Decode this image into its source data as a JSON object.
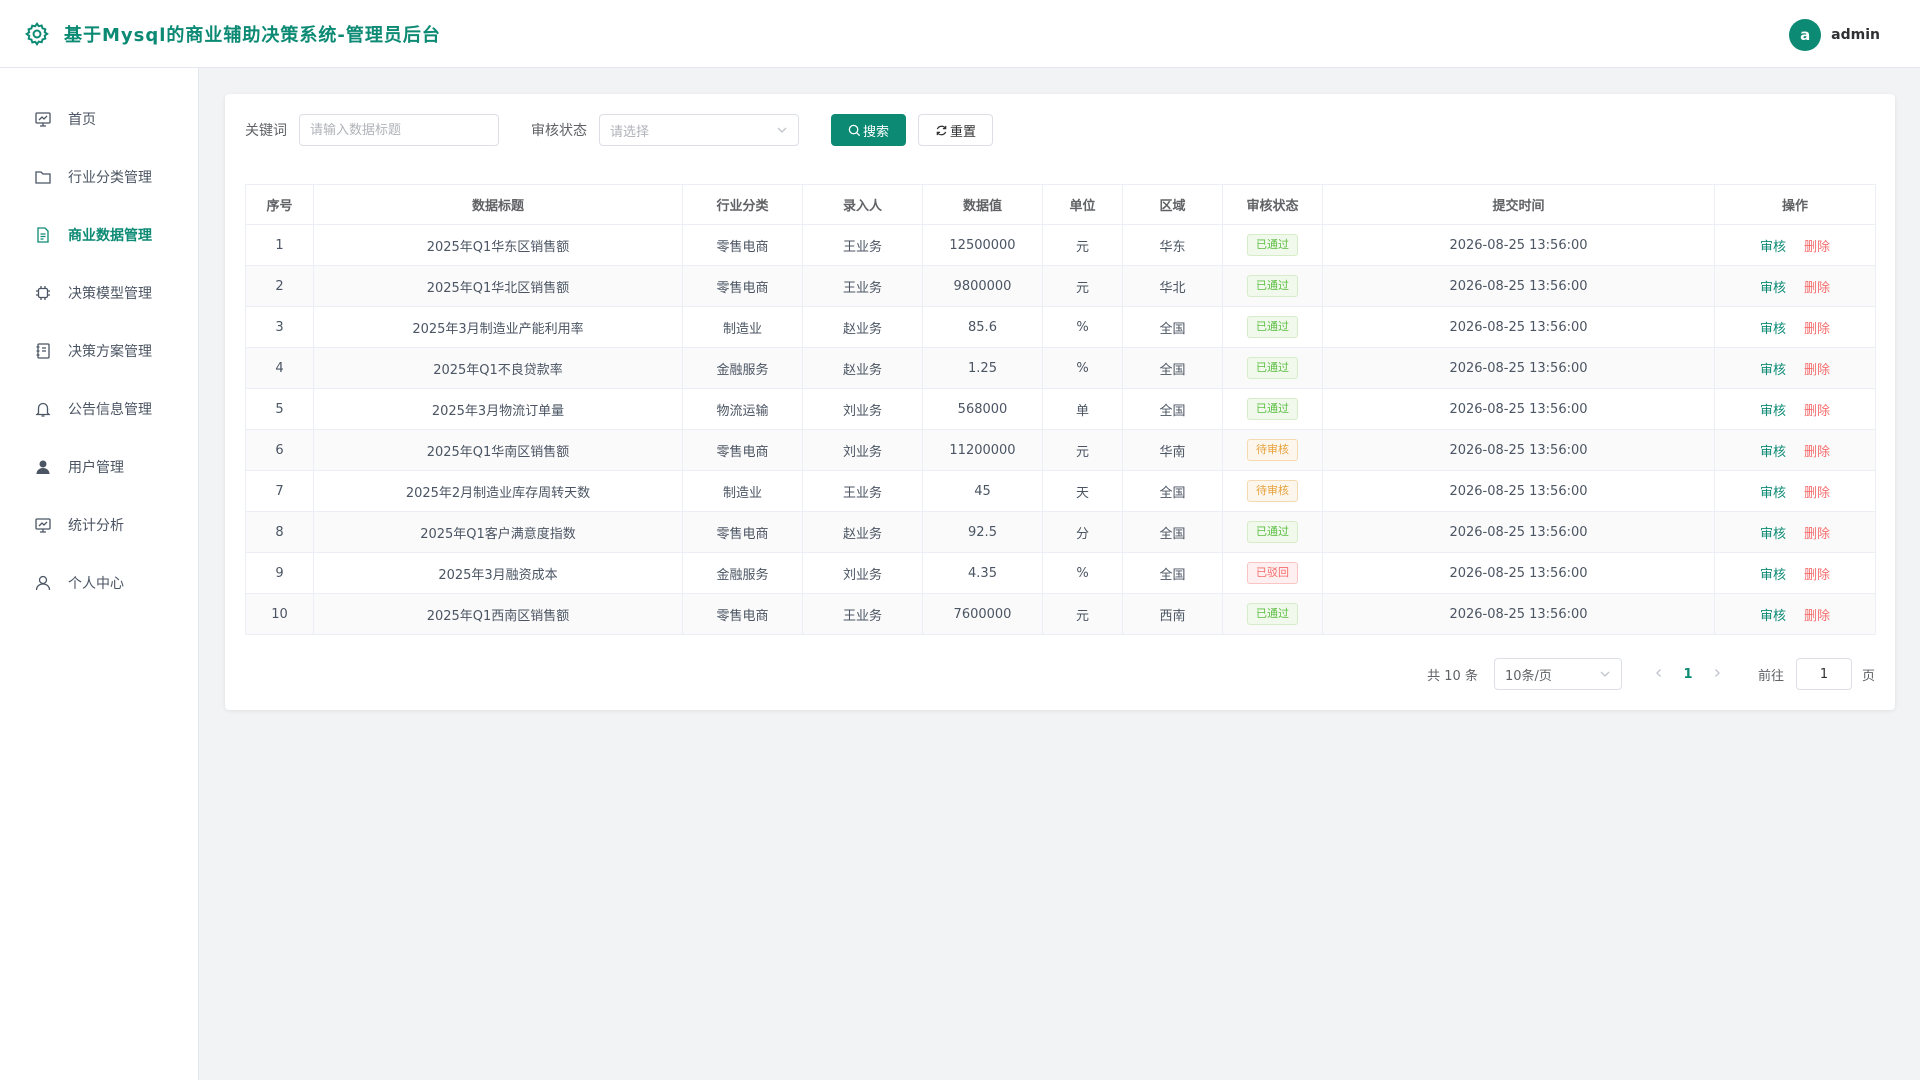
{
  "header": {
    "title": "基于Mysql的商业辅助决策系统-管理员后台",
    "avatar_letter": "a",
    "username": "admin"
  },
  "sidebar": {
    "items": [
      {
        "label": "首页",
        "icon": "chart-board-icon",
        "active": false
      },
      {
        "label": "行业分类管理",
        "icon": "folder-icon",
        "active": false
      },
      {
        "label": "商业数据管理",
        "icon": "document-icon",
        "active": true
      },
      {
        "label": "决策模型管理",
        "icon": "cpu-icon",
        "active": false
      },
      {
        "label": "决策方案管理",
        "icon": "notebook-icon",
        "active": false
      },
      {
        "label": "公告信息管理",
        "icon": "bell-icon",
        "active": false
      },
      {
        "label": "用户管理",
        "icon": "user-filled-icon",
        "active": false
      },
      {
        "label": "统计分析",
        "icon": "chart-board-icon",
        "active": false
      },
      {
        "label": "个人中心",
        "icon": "user-icon",
        "active": false
      }
    ]
  },
  "filters": {
    "keyword_label": "关键词",
    "keyword_placeholder": "请输入数据标题",
    "status_label": "审核状态",
    "status_placeholder": "请选择",
    "search_label": "搜索",
    "reset_label": "重置"
  },
  "table": {
    "headers": [
      "序号",
      "数据标题",
      "行业分类",
      "录入人",
      "数据值",
      "单位",
      "区域",
      "审核状态",
      "提交时间",
      "操作"
    ],
    "rows": [
      {
        "no": "1",
        "title": "2025年Q1华东区销售额",
        "industry": "零售电商",
        "entrant": "王业务",
        "value": "12500000",
        "unit": "元",
        "region": "华东",
        "status": "已通过",
        "status_type": "ok",
        "time": "2026-08-25 13:56:00"
      },
      {
        "no": "2",
        "title": "2025年Q1华北区销售额",
        "industry": "零售电商",
        "entrant": "王业务",
        "value": "9800000",
        "unit": "元",
        "region": "华北",
        "status": "已通过",
        "status_type": "ok",
        "time": "2026-08-25 13:56:00"
      },
      {
        "no": "3",
        "title": "2025年3月制造业产能利用率",
        "industry": "制造业",
        "entrant": "赵业务",
        "value": "85.6",
        "unit": "%",
        "region": "全国",
        "status": "已通过",
        "status_type": "ok",
        "time": "2026-08-25 13:56:00"
      },
      {
        "no": "4",
        "title": "2025年Q1不良贷款率",
        "industry": "金融服务",
        "entrant": "赵业务",
        "value": "1.25",
        "unit": "%",
        "region": "全国",
        "status": "已通过",
        "status_type": "ok",
        "time": "2026-08-25 13:56:00"
      },
      {
        "no": "5",
        "title": "2025年3月物流订单量",
        "industry": "物流运输",
        "entrant": "刘业务",
        "value": "568000",
        "unit": "单",
        "region": "全国",
        "status": "已通过",
        "status_type": "ok",
        "time": "2026-08-25 13:56:00"
      },
      {
        "no": "6",
        "title": "2025年Q1华南区销售额",
        "industry": "零售电商",
        "entrant": "刘业务",
        "value": "11200000",
        "unit": "元",
        "region": "华南",
        "status": "待审核",
        "status_type": "pending",
        "time": "2026-08-25 13:56:00"
      },
      {
        "no": "7",
        "title": "2025年2月制造业库存周转天数",
        "industry": "制造业",
        "entrant": "王业务",
        "value": "45",
        "unit": "天",
        "region": "全国",
        "status": "待审核",
        "status_type": "pending",
        "time": "2026-08-25 13:56:00"
      },
      {
        "no": "8",
        "title": "2025年Q1客户满意度指数",
        "industry": "零售电商",
        "entrant": "赵业务",
        "value": "92.5",
        "unit": "分",
        "region": "全国",
        "status": "已通过",
        "status_type": "ok",
        "time": "2026-08-25 13:56:00"
      },
      {
        "no": "9",
        "title": "2025年3月融资成本",
        "industry": "金融服务",
        "entrant": "刘业务",
        "value": "4.35",
        "unit": "%",
        "region": "全国",
        "status": "已驳回",
        "status_type": "rejected",
        "time": "2026-08-25 13:56:00"
      },
      {
        "no": "10",
        "title": "2025年Q1西南区销售额",
        "industry": "零售电商",
        "entrant": "王业务",
        "value": "7600000",
        "unit": "元",
        "region": "西南",
        "status": "已通过",
        "status_type": "ok",
        "time": "2026-08-25 13:56:00"
      }
    ],
    "action_audit": "审核",
    "action_delete": "删除"
  },
  "pagination": {
    "total_text": "共 10 条",
    "page_size": "10条/页",
    "current_page": "1",
    "goto_label": "前往",
    "goto_value": "1",
    "page_suffix": "页"
  },
  "colors": {
    "primary": "#0c8a74",
    "success": "#5dbf44",
    "warning": "#e6a23c",
    "danger": "#f56c6c"
  }
}
